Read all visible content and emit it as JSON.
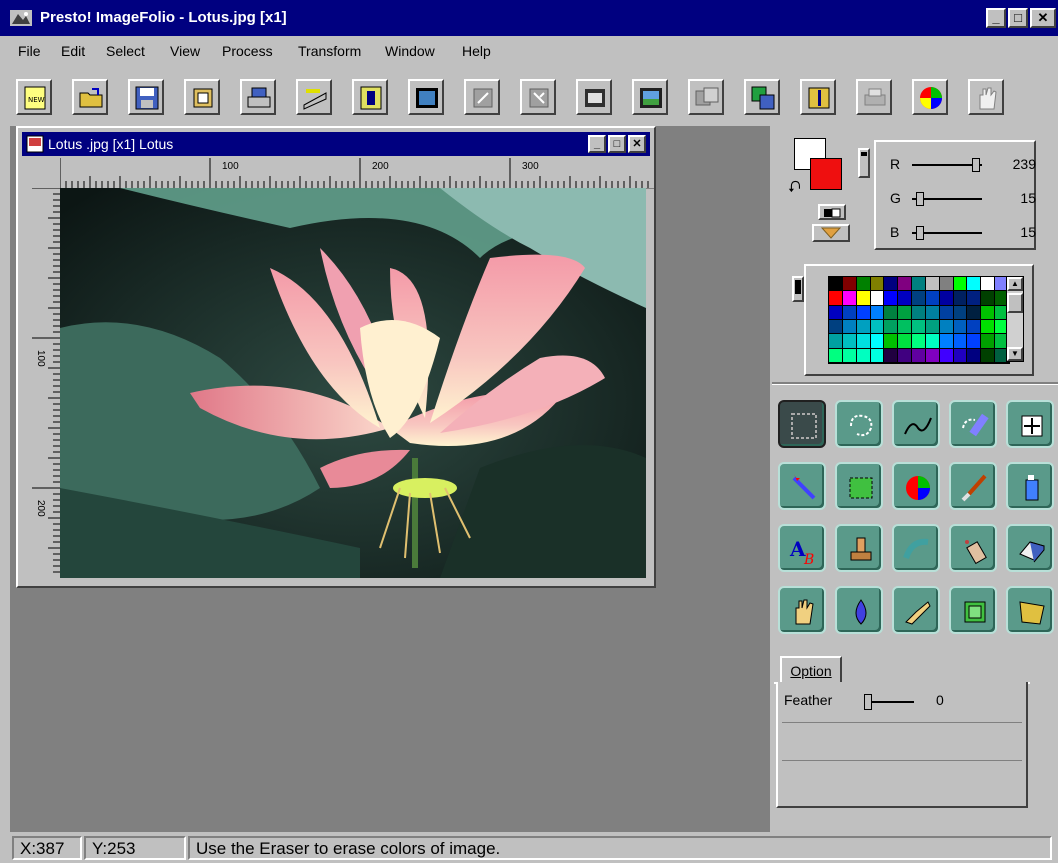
{
  "app": {
    "title": "Presto! ImageFolio - Lotus.jpg [x1]"
  },
  "menu": {
    "items": [
      "File",
      "Edit",
      "Select",
      "View",
      "Process",
      "Transform",
      "Window",
      "Help"
    ]
  },
  "toolbar": {
    "icons": [
      "new-icon",
      "open-icon",
      "save-icon",
      "browse-icon",
      "scan-icon",
      "scanner-icon",
      "info-icon",
      "image-frame-icon",
      "crop-icon",
      "rotate-icon",
      "flip-icon",
      "resize-icon",
      "effect-icon",
      "convert-icon",
      "mirror-icon",
      "print-icon",
      "color-wheel-icon",
      "hand-icon"
    ]
  },
  "document": {
    "title": "Lotus .jpg [x1] Lotus",
    "ruler_h": [
      "100",
      "200",
      "300"
    ],
    "ruler_v": [
      "100",
      "200"
    ]
  },
  "color": {
    "foreground": "#ef0f0f",
    "background": "#ffffff",
    "r_label": "R",
    "g_label": "G",
    "b_label": "B",
    "r": "239",
    "g": "15",
    "b": "15",
    "r_level": 0.94,
    "g_level": 0.06,
    "b_level": 0.06
  },
  "palette": {
    "colors": [
      "#000000",
      "#800000",
      "#008000",
      "#808000",
      "#000080",
      "#800080",
      "#008080",
      "#c0c0c0",
      "#808080",
      "#00ff00",
      "#00ffff",
      "#ffffff",
      "#8080ff",
      "#ff0000",
      "#ff00ff",
      "#ffff00",
      "#ffffff",
      "#0000ff",
      "#0000c0",
      "#004080",
      "#0040c0",
      "#0000a0",
      "#002060",
      "#002080",
      "#004000",
      "#006000",
      "#0000c0",
      "#0040c0",
      "#0040ff",
      "#0080ff",
      "#008040",
      "#00a040",
      "#008080",
      "#0080a0",
      "#0040a0",
      "#004080",
      "#002040",
      "#00c000",
      "#00c040",
      "#004080",
      "#0080c0",
      "#00a0c0",
      "#00c0c0",
      "#00a060",
      "#00c060",
      "#00c080",
      "#00a080",
      "#0080c0",
      "#0060c0",
      "#0040c0",
      "#00e000",
      "#00ff40",
      "#00a0a0",
      "#00c0c0",
      "#00e0e0",
      "#00ffff",
      "#00c000",
      "#00e040",
      "#00ff80",
      "#00ffc0",
      "#0080ff",
      "#0060ff",
      "#0040ff",
      "#00a000",
      "#00c040",
      "#00ff80",
      "#00ffa0",
      "#00ffc0",
      "#00ffe0",
      "#200040",
      "#400080",
      "#6000a0",
      "#8000c0",
      "#4000ff",
      "#2000c0",
      "#000080",
      "#004000",
      "#006040"
    ]
  },
  "tools": [
    "marquee-select-icon",
    "lasso-icon",
    "freehand-line-icon",
    "magic-lasso-icon",
    "move-icon",
    "magic-wand-icon",
    "rectangle-select-icon",
    "color-picker-icon",
    "paint-brush-icon",
    "spray-can-icon",
    "text-icon",
    "stamp-icon",
    "smudge-icon",
    "airbrush-icon",
    "eraser-icon",
    "hand-icon",
    "water-drop-icon",
    "pointing-hand-icon",
    "crop-tool-icon",
    "perspective-icon"
  ],
  "options": {
    "tab_label": "Option",
    "feather_label": "Feather",
    "feather_value": "0",
    "feather_level": 0.0
  },
  "status": {
    "x": "X:387",
    "y": "Y:253",
    "message": "Use the Eraser to erase colors of image."
  }
}
